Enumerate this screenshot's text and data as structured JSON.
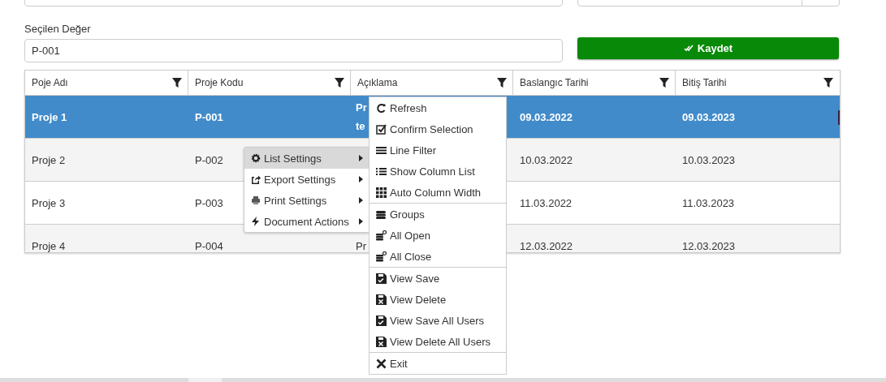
{
  "selected_value": {
    "label": "Seçilen Değer",
    "value": "P-001"
  },
  "save_button": {
    "label": "Kaydet"
  },
  "table": {
    "columns": [
      "Poje Adı",
      "Proje Kodu",
      "Açıklama",
      "Baslangıc Tarihi",
      "Bitiş Tarihi"
    ],
    "rows": [
      {
        "name": "Proje 1",
        "code": "P-001",
        "description": [
          "Pr",
          "te"
        ],
        "start": "09.03.2022",
        "end": "09.03.2023",
        "selected": true
      },
      {
        "name": "Proje 2",
        "code": "P-002",
        "description": [],
        "start": "10.03.2022",
        "end": "10.03.2023",
        "selected": false
      },
      {
        "name": "Proje 3",
        "code": "P-003",
        "description": [],
        "start": "11.03.2022",
        "end": "11.03.2023",
        "selected": false
      },
      {
        "name": "Proje 4",
        "code": "P-004",
        "description": [
          "Pr"
        ],
        "start": "12.03.2022",
        "end": "12.03.2023",
        "selected": false
      }
    ]
  },
  "context_menu": {
    "items": [
      {
        "label": "List Settings",
        "selected": true
      },
      {
        "label": "Export Settings",
        "selected": false
      },
      {
        "label": "Print Settings",
        "selected": false
      },
      {
        "label": "Document Actions",
        "selected": false
      }
    ]
  },
  "submenu": {
    "groups": [
      [
        "Refresh",
        "Confirm Selection",
        "Line Filter",
        "Show Column List",
        "Auto Column Width"
      ],
      [
        "Groups",
        "All Open",
        "All Close"
      ],
      [
        "View Save",
        "View Delete",
        "View Save All Users",
        "View Delete All Users"
      ],
      [
        "Exit"
      ]
    ]
  }
}
